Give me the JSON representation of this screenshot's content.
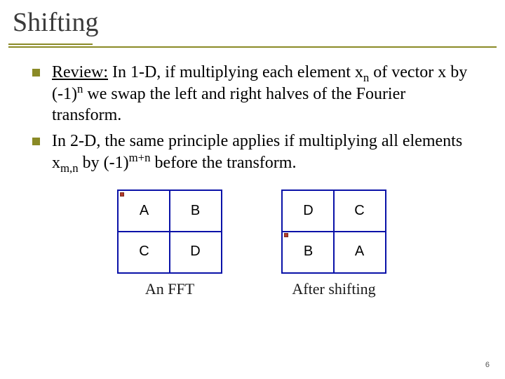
{
  "title": "Shifting",
  "bullets": [
    {
      "prefix_u": "Review:",
      "t1": " In 1-D, if multiplying each element x",
      "sub1": "n",
      "t2": " of vector x by (-1)",
      "sup1": "n",
      "t3": " we swap the left and right halves of the Fourier transform."
    },
    {
      "t1": "In 2-D, the same principle applies if multiplying all elements x",
      "sub1": "m,n",
      "t2": " by (-1)",
      "sup1": "m+n",
      "t3": " before the transform."
    }
  ],
  "diagrams": {
    "left": {
      "cells": [
        "A",
        "B",
        "C",
        "D"
      ],
      "caption": "An FFT"
    },
    "right": {
      "cells": [
        "D",
        "C",
        "B",
        "A"
      ],
      "caption": "After shifting"
    }
  },
  "page_number": "6"
}
